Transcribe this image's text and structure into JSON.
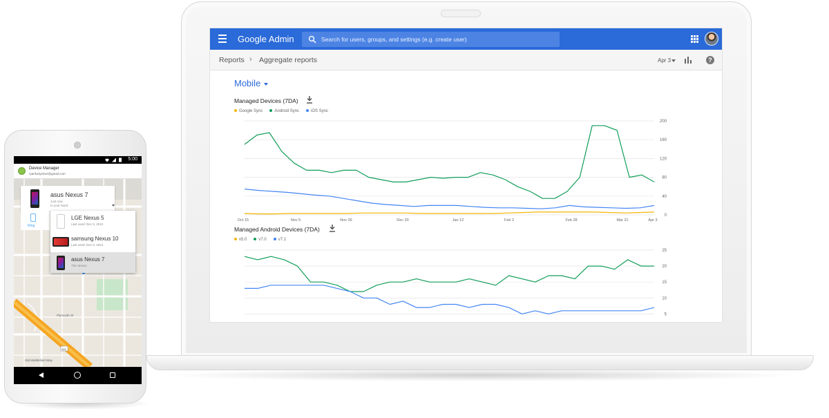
{
  "admin": {
    "product_name": "Google Admin",
    "search_placeholder": "Search for users, groups, and settings (e.g. create user)",
    "breadcrumb": [
      "Reports",
      "Aggregate reports"
    ],
    "breadcrumb_separator": "›",
    "date_select": "Apr 3",
    "help_label": "?",
    "section_title": "Mobile",
    "accent_color": "#2a6ad9"
  },
  "charts": {
    "managed_devices_title": "Managed Devices (7DA)",
    "android_devices_title": "Managed Android Devices (7DA)"
  },
  "chart_data": [
    {
      "type": "line",
      "title": "Managed Devices (7DA)",
      "categories": [
        "Oct 15",
        "Nov 5",
        "Nov 26",
        "Dec 20",
        "Jan 12",
        "Feb 2",
        "Feb 28",
        "Mar 21",
        "Apr 3"
      ],
      "yticks": [
        0,
        40,
        80,
        120,
        160,
        200
      ],
      "ylim": [
        0,
        200
      ],
      "legend": "top-left",
      "grid": true,
      "series": [
        {
          "name": "Google Sync",
          "color": "#f4b400",
          "values": [
            3,
            2,
            2,
            3,
            3,
            3,
            3,
            3,
            4,
            4,
            4,
            4,
            3,
            3,
            3,
            3,
            3,
            3,
            4,
            5,
            6,
            6,
            6,
            6,
            6,
            5,
            4,
            5,
            6
          ]
        },
        {
          "name": "Android Sync",
          "color": "#0f9d58",
          "values": [
            150,
            170,
            175,
            135,
            110,
            95,
            95,
            90,
            95,
            95,
            80,
            75,
            70,
            70,
            75,
            80,
            78,
            80,
            80,
            90,
            85,
            75,
            60,
            50,
            35,
            35,
            50,
            80,
            190,
            190,
            180,
            80,
            85,
            70
          ]
        },
        {
          "name": "iOS Sync",
          "color": "#4285f4",
          "values": [
            55,
            52,
            50,
            48,
            45,
            42,
            40,
            35,
            30,
            25,
            22,
            20,
            18,
            20,
            20,
            20,
            18,
            16,
            15,
            15,
            14,
            13,
            15,
            20,
            17,
            16,
            15,
            14,
            15,
            20
          ]
        }
      ]
    },
    {
      "type": "line",
      "title": "Managed Android Devices (7DA)",
      "yticks": [
        5,
        10,
        15,
        20,
        25
      ],
      "ylim": [
        4,
        25
      ],
      "legend": "top-left",
      "grid": true,
      "series": [
        {
          "name": "v5.0",
          "color": "#f4b400",
          "values": []
        },
        {
          "name": "v7.0",
          "color": "#0f9d58",
          "values": [
            23,
            22,
            23,
            22,
            20,
            15,
            15,
            14,
            12,
            12,
            14,
            15,
            15,
            16,
            15,
            15,
            15,
            16,
            15,
            14,
            17,
            16,
            15,
            17,
            17,
            16,
            20,
            20,
            19,
            22,
            20,
            20
          ]
        },
        {
          "name": "v7.1",
          "color": "#4285f4",
          "values": [
            13,
            13,
            14,
            14,
            14,
            14,
            14,
            13,
            12,
            10,
            10,
            8,
            9,
            7,
            7,
            8,
            8,
            7,
            8,
            8,
            7,
            5,
            6,
            5,
            6,
            6,
            6,
            6,
            6,
            6,
            6,
            7
          ]
        }
      ]
    }
  ],
  "phone": {
    "status_time": "5:00",
    "app_title": "Device Manager",
    "account": "ryanfortyeiner@gmail.com",
    "selected_device": {
      "name": "asus Nexus 7",
      "status_line1": "Just now",
      "status_line2": "In your hand"
    },
    "ring_label": "Ring",
    "devices": [
      {
        "name": "LGE Nexus 5",
        "sub": "Last used: Dec 5, 2013"
      },
      {
        "name": "samsung Nexus 10",
        "sub": "Last used: Dec 5, 2013"
      },
      {
        "name": "asus Nexus 7",
        "sub": "This device"
      }
    ],
    "map_labels": {
      "plymouth": "Plymouth St",
      "old_middlefield": "Old Middlefield Way",
      "highway": "101"
    }
  }
}
